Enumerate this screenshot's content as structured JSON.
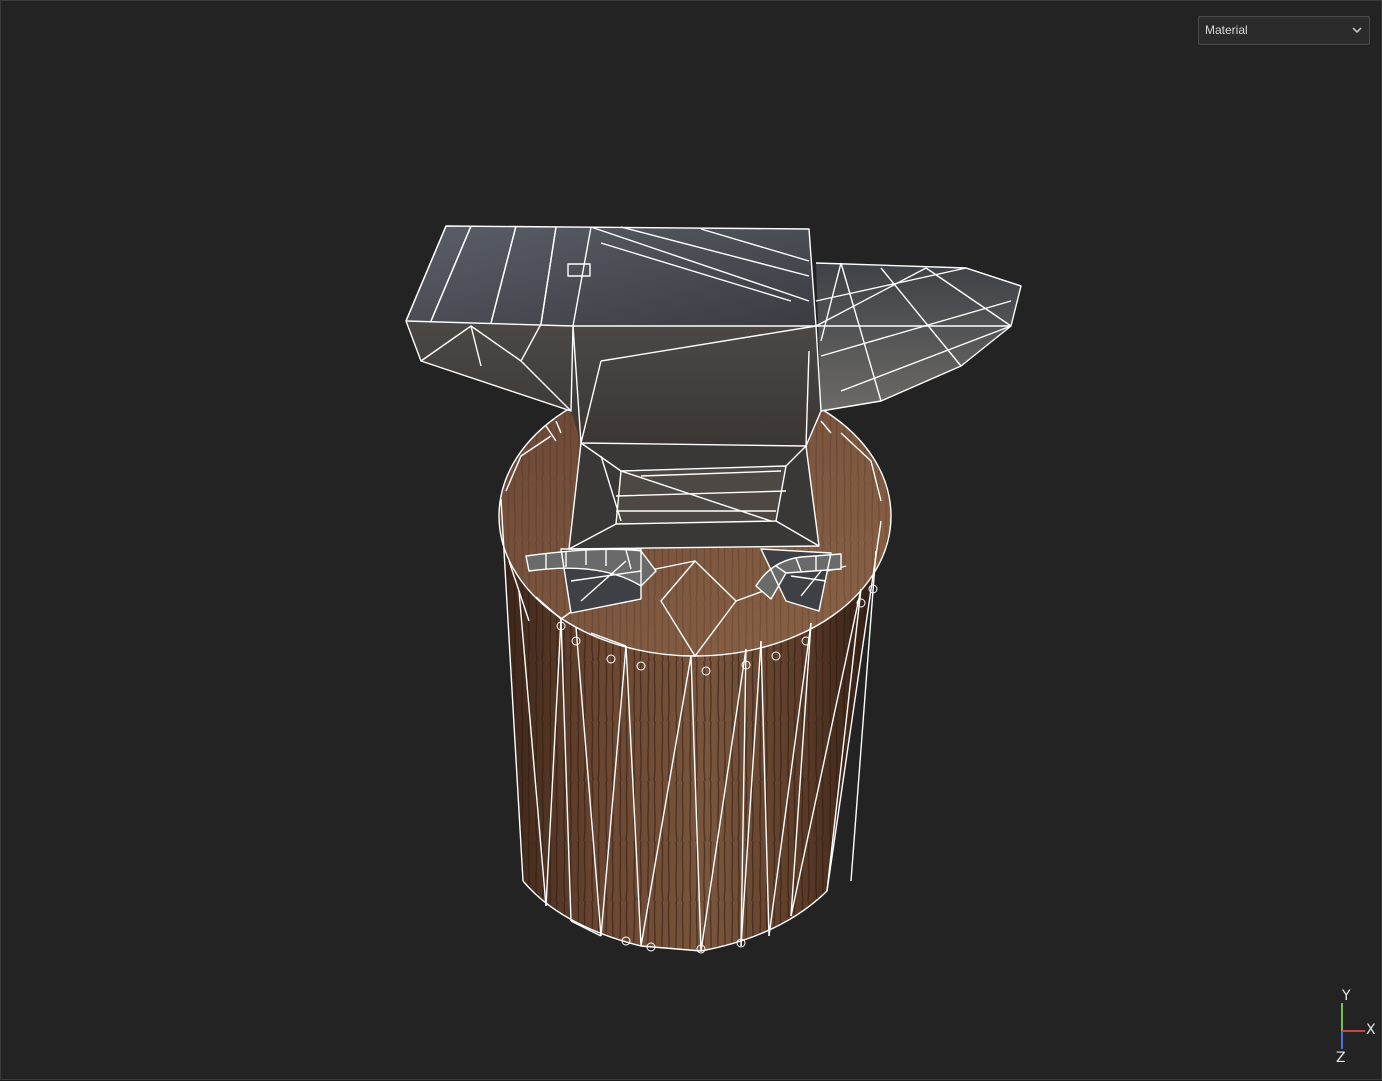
{
  "viewport": {
    "view_mode": {
      "selected": "Material"
    },
    "axis_gizmo": {
      "x_label": "X",
      "y_label": "Y",
      "z_label": "Z"
    },
    "model": {
      "object": "anvil-on-stump",
      "render_style": "textured-with-wireframe-overlay"
    }
  },
  "colors": {
    "background": "#232323",
    "wireframe": "#ffffff",
    "metal": "#4a4c52",
    "wood": "#6b4a33",
    "axis_x": "#d84040",
    "axis_y": "#6fc24b",
    "axis_z": "#4a74d8"
  }
}
